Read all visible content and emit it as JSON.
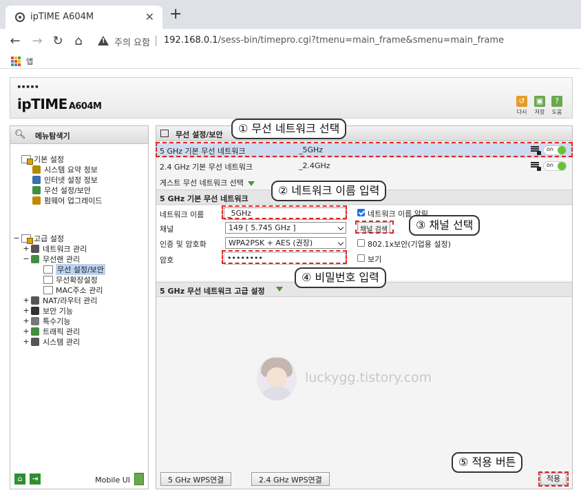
{
  "browser": {
    "tab_title": "ipTIME A604M",
    "tab_close": "✕",
    "new_tab": "+",
    "security_text": "주의 요함",
    "url_host": "192.168.0.1",
    "url_path": "/sess-bin/timepro.cgi?tmenu=main_frame&smenu=main_frame",
    "bookmark_apps": "앱"
  },
  "header": {
    "logo_dots": "▪▪▪▪▪",
    "logo_brand": "ipTIME",
    "logo_model": "A604M",
    "buttons": [
      {
        "label": "다시",
        "color": "#e69b24"
      },
      {
        "label": "저장",
        "color": "#6aa84f"
      },
      {
        "label": "도움",
        "color": "#6aa84f",
        "glyph": "?"
      }
    ]
  },
  "left_panel": {
    "title": "메뉴탐색기",
    "items": [
      {
        "label": "기본 설정",
        "toggle": ""
      },
      {
        "label": "시스템 요약 정보"
      },
      {
        "label": "인터넷 설정 정보"
      },
      {
        "label": "무선 설정/보안"
      },
      {
        "label": "펌웨어 업그레이드"
      },
      {
        "label": "고급 설정",
        "toggle": "−"
      },
      {
        "label": "네트워크 관리",
        "toggle": "+"
      },
      {
        "label": "무선랜 관리",
        "toggle": "−"
      },
      {
        "label": "무선 설정/보안"
      },
      {
        "label": "무선확장설정"
      },
      {
        "label": "MAC주소 관리"
      },
      {
        "label": "NAT/라우터 관리",
        "toggle": "+"
      },
      {
        "label": "보안 기능",
        "toggle": "+"
      },
      {
        "label": "특수기능",
        "toggle": "+"
      },
      {
        "label": "트래픽 관리",
        "toggle": "+"
      },
      {
        "label": "시스템 관리",
        "toggle": "+"
      }
    ],
    "mobile_ui": "Mobile UI"
  },
  "right_panel": {
    "title": "무선 설정/보안",
    "networks": [
      {
        "band": "5 GHz 기본 무선 네트워크",
        "ssid": "_5GHz",
        "toggle": "on"
      },
      {
        "band": "2.4 GHz 기본 무선 네트워크",
        "ssid": "_2.4GHz",
        "toggle": "on"
      }
    ],
    "guest_label": "게스트 무선 네트워크 선택",
    "section_basic": "5 GHz 기본 무선 네트워크",
    "form": {
      "name_label": "네트워크 이름",
      "name_value": "_5GHz",
      "broadcast_label": "네트워크 이름 알림",
      "channel_label": "채널",
      "channel_value": "149 [ 5.745 GHz ]",
      "channel_search": "채널 검색",
      "auth_label": "인증 및 암호화",
      "auth_value": "WPA2PSK + AES (권장)",
      "enterprise_label": "802.1x보안(기업용 설정)",
      "password_label": "암호",
      "password_value": "••••••••",
      "show_label": "보기"
    },
    "section_advanced": "5 GHz 무선 네트워크 고급 설정",
    "watermark": "luckygg.tistory.com",
    "wps_5": "5 GHz WPS연결",
    "wps_24": "2.4 GHz WPS연결",
    "apply": "적용"
  },
  "callouts": {
    "c1": "① 무선 네트워크 선택",
    "c2": "② 네트워크 이름 입력",
    "c3": "③ 채널 선택",
    "c4": "④ 비밀번호 입력",
    "c5": "⑤ 적용 버튼"
  },
  "colors": {
    "highlight": "#e02424",
    "selected_row": "#cfdcef",
    "toggle_on": "#67c23a"
  }
}
